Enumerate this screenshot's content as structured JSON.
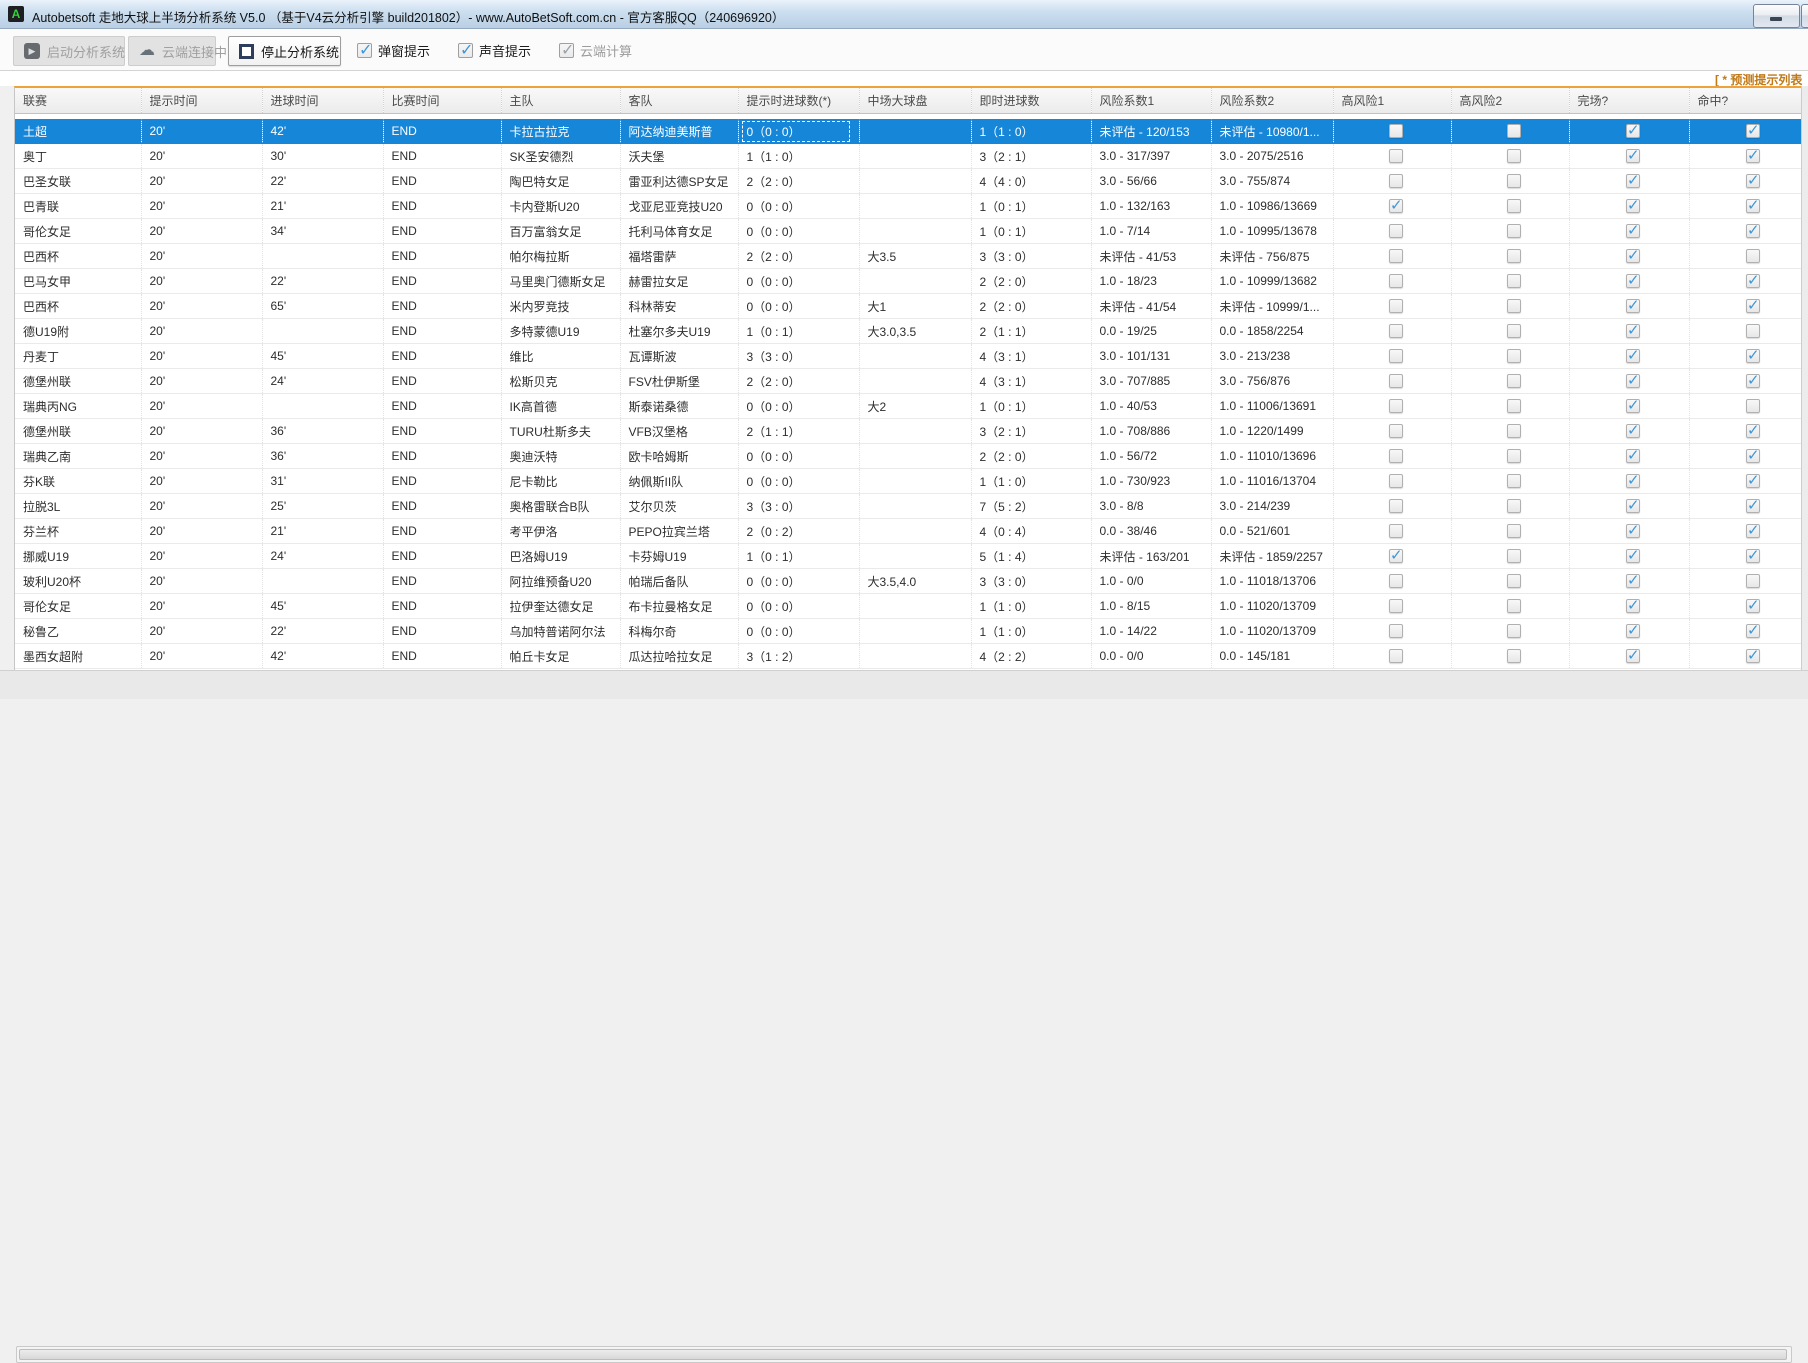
{
  "window": {
    "title": "Autobetsoft 走地大球上半场分析系统 V5.0 （基于V4云分析引擎 build201802）- www.AutoBetSoft.com.cn - 官方客服QQ（240696920）",
    "icon_letter": "A"
  },
  "toolbar": {
    "start_label": "启动分析系统",
    "cloud_label": "云端连接中",
    "stop_label": "停止分析系统",
    "options": [
      {
        "label": "弹窗提示",
        "checked": true,
        "enabled": true
      },
      {
        "label": "声音提示",
        "checked": true,
        "enabled": true
      },
      {
        "label": "云端计算",
        "checked": true,
        "enabled": false
      }
    ]
  },
  "grid": {
    "note": "[ * 预测提示列表",
    "headers": [
      "联赛",
      "提示时间",
      "进球时间",
      "比赛时间",
      "主队",
      "客队",
      "提示时进球数(*)",
      "中场大球盘",
      "即时进球数",
      "风险系数1",
      "风险系数2",
      "高风险1",
      "高风险2",
      "完场?",
      "命中?"
    ],
    "selected_row": 0,
    "focus_col": 6,
    "rows": [
      {
        "cells": [
          "土超",
          "20'",
          "42'",
          "END",
          "卡拉古拉克",
          "阿达纳迪美斯普",
          "0（0 : 0）",
          "",
          "1（1 : 0）",
          "未评估 - 120/153",
          "未评估 - 10980/1..."
        ],
        "checks": [
          false,
          false,
          true,
          true
        ]
      },
      {
        "cells": [
          "奥丁",
          "20'",
          "30'",
          "END",
          "SK圣安德烈",
          "沃夫堡",
          "1（1 : 0）",
          "",
          "3（2 : 1）",
          "3.0 - 317/397",
          "3.0 - 2075/2516"
        ],
        "checks": [
          false,
          false,
          true,
          true
        ]
      },
      {
        "cells": [
          "巴圣女联",
          "20'",
          "22'",
          "END",
          "陶巴特女足",
          "雷亚利达德SP女足",
          "2（2 : 0）",
          "",
          "4（4 : 0）",
          "3.0 - 56/66",
          "3.0 - 755/874"
        ],
        "checks": [
          false,
          false,
          true,
          true
        ]
      },
      {
        "cells": [
          "巴青联",
          "20'",
          "21'",
          "END",
          "卡内登斯U20",
          "戈亚尼亚竞技U20",
          "0（0 : 0）",
          "",
          "1（0 : 1）",
          "1.0 - 132/163",
          "1.0 - 10986/13669"
        ],
        "checks": [
          true,
          false,
          true,
          true
        ]
      },
      {
        "cells": [
          "哥伦女足",
          "20'",
          "34'",
          "END",
          "百万富翁女足",
          "托利马体育女足",
          "0（0 : 0）",
          "",
          "1（0 : 1）",
          "1.0 - 7/14",
          "1.0 - 10995/13678"
        ],
        "checks": [
          false,
          false,
          true,
          true
        ]
      },
      {
        "cells": [
          "巴西杯",
          "20'",
          "",
          "END",
          "帕尔梅拉斯",
          "福塔雷萨",
          "2（2 : 0）",
          "大3.5",
          "3（3 : 0）",
          "未评估 - 41/53",
          "未评估 - 756/875"
        ],
        "checks": [
          false,
          false,
          true,
          false
        ]
      },
      {
        "cells": [
          "巴马女甲",
          "20'",
          "22'",
          "END",
          "马里奥门德斯女足",
          "赫雷拉女足",
          "0（0 : 0）",
          "",
          "2（2 : 0）",
          "1.0 - 18/23",
          "1.0 - 10999/13682"
        ],
        "checks": [
          false,
          false,
          true,
          true
        ]
      },
      {
        "cells": [
          "巴西杯",
          "20'",
          "65'",
          "END",
          "米内罗竞技",
          "科林蒂安",
          "0（0 : 0）",
          "大1",
          "2（2 : 0）",
          "未评估 - 41/54",
          "未评估 - 10999/1..."
        ],
        "checks": [
          false,
          false,
          true,
          true
        ]
      },
      {
        "cells": [
          "德U19附",
          "20'",
          "",
          "END",
          "多特蒙德U19",
          "杜塞尔多夫U19",
          "1（0 : 1）",
          "大3.0,3.5",
          "2（1 : 1）",
          "0.0 - 19/25",
          "0.0 - 1858/2254"
        ],
        "checks": [
          false,
          false,
          true,
          false
        ]
      },
      {
        "cells": [
          "丹麦丁",
          "20'",
          "45'",
          "END",
          "维比",
          "瓦谭斯波",
          "3（3 : 0）",
          "",
          "4（3 : 1）",
          "3.0 - 101/131",
          "3.0 - 213/238"
        ],
        "checks": [
          false,
          false,
          true,
          true
        ]
      },
      {
        "cells": [
          "德堡州联",
          "20'",
          "24'",
          "END",
          "松斯贝克",
          "FSV杜伊斯堡",
          "2（2 : 0）",
          "",
          "4（3 : 1）",
          "3.0 - 707/885",
          "3.0 - 756/876"
        ],
        "checks": [
          false,
          false,
          true,
          true
        ]
      },
      {
        "cells": [
          "瑞典丙NG",
          "20'",
          "",
          "END",
          "IK高首德",
          "斯泰诺桑德",
          "0（0 : 0）",
          "大2",
          "1（0 : 1）",
          "1.0 - 40/53",
          "1.0 - 11006/13691"
        ],
        "checks": [
          false,
          false,
          true,
          false
        ]
      },
      {
        "cells": [
          "德堡州联",
          "20'",
          "36'",
          "END",
          "TURU杜斯多夫",
          "VFB汉堡格",
          "2（1 : 1）",
          "",
          "3（2 : 1）",
          "1.0 - 708/886",
          "1.0 - 1220/1499"
        ],
        "checks": [
          false,
          false,
          true,
          true
        ]
      },
      {
        "cells": [
          "瑞典乙南",
          "20'",
          "36'",
          "END",
          "奥迪沃特",
          "欧卡哈姆斯",
          "0（0 : 0）",
          "",
          "2（2 : 0）",
          "1.0 - 56/72",
          "1.0 - 11010/13696"
        ],
        "checks": [
          false,
          false,
          true,
          true
        ]
      },
      {
        "cells": [
          "芬K联",
          "20'",
          "31'",
          "END",
          "尼卡勒比",
          "纳佩斯II队",
          "0（0 : 0）",
          "",
          "1（1 : 0）",
          "1.0 - 730/923",
          "1.0 - 11016/13704"
        ],
        "checks": [
          false,
          false,
          true,
          true
        ]
      },
      {
        "cells": [
          "拉脱3L",
          "20'",
          "25'",
          "END",
          "奥格雷联合B队",
          "艾尔贝茨",
          "3（3 : 0）",
          "",
          "7（5 : 2）",
          "3.0 - 8/8",
          "3.0 - 214/239"
        ],
        "checks": [
          false,
          false,
          true,
          true
        ]
      },
      {
        "cells": [
          "芬兰杯",
          "20'",
          "21'",
          "END",
          "考平伊洛",
          "PEPO拉宾兰塔",
          "2（0 : 2）",
          "",
          "4（0 : 4）",
          "0.0 - 38/46",
          "0.0 - 521/601"
        ],
        "checks": [
          false,
          false,
          true,
          true
        ]
      },
      {
        "cells": [
          "挪威U19",
          "20'",
          "24'",
          "END",
          "巴洛姆U19",
          "卡芬姆U19",
          "1（0 : 1）",
          "",
          "5（1 : 4）",
          "未评估 - 163/201",
          "未评估 - 1859/2257"
        ],
        "checks": [
          true,
          false,
          true,
          true
        ]
      },
      {
        "cells": [
          "玻利U20杯",
          "20'",
          "",
          "END",
          "阿拉维预备U20",
          "帕瑞后备队",
          "0（0 : 0）",
          "大3.5,4.0",
          "3（3 : 0）",
          "1.0 - 0/0",
          "1.0 - 11018/13706"
        ],
        "checks": [
          false,
          false,
          true,
          false
        ]
      },
      {
        "cells": [
          "哥伦女足",
          "20'",
          "45'",
          "END",
          "拉伊奎达德女足",
          "布卡拉曼格女足",
          "0（0 : 0）",
          "",
          "1（1 : 0）",
          "1.0 - 8/15",
          "1.0 - 11020/13709"
        ],
        "checks": [
          false,
          false,
          true,
          true
        ]
      },
      {
        "cells": [
          "秘鲁乙",
          "20'",
          "22'",
          "END",
          "乌加特普诺阿尔法",
          "科梅尔奇",
          "0（0 : 0）",
          "",
          "1（1 : 0）",
          "1.0 - 14/22",
          "1.0 - 11020/13709"
        ],
        "checks": [
          false,
          false,
          true,
          true
        ]
      },
      {
        "cells": [
          "墨西女超附",
          "20'",
          "42'",
          "END",
          "帕丘卡女足",
          "瓜达拉哈拉女足",
          "3（1 : 2）",
          "",
          "4（2 : 2）",
          "0.0 - 0/0",
          "0.0 - 145/181"
        ],
        "checks": [
          false,
          false,
          true,
          true
        ]
      }
    ]
  },
  "colors": {
    "selection_blue": "#1686d9",
    "accent_orange": "#f0a23a",
    "check_blue": "#3f96d8"
  }
}
